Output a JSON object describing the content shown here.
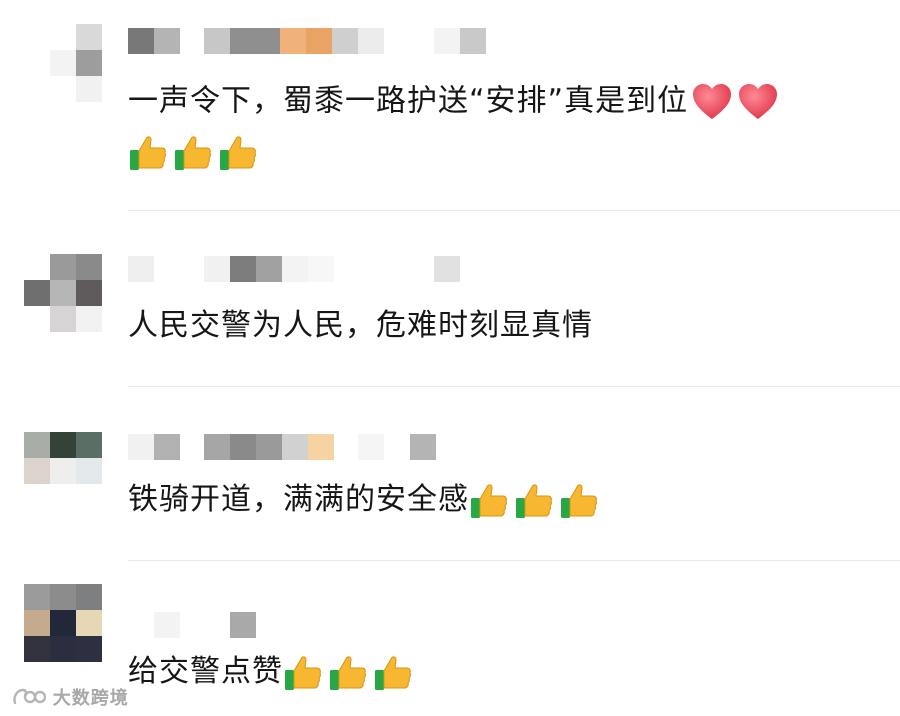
{
  "comments": [
    {
      "text": "一声令下，蜀黍一路护送“安排”真是到位",
      "emojis_inline": [
        "red-heart",
        "red-heart"
      ],
      "emojis_line2": [
        "thumbs-up",
        "thumbs-up",
        "thumbs-up"
      ]
    },
    {
      "text": "人民交警为人民，危难时刻显真情",
      "emojis_inline": [],
      "emojis_line2": []
    },
    {
      "text": "铁骑开道，满满的安全感",
      "emojis_inline": [
        "thumbs-up",
        "thumbs-up",
        "thumbs-up"
      ],
      "emojis_line2": []
    },
    {
      "text": "给交警点赞",
      "emojis_inline": [
        "thumbs-up",
        "thumbs-up",
        "thumbs-up"
      ],
      "emojis_line2": []
    }
  ],
  "watermark": {
    "text": "大数跨境",
    "icon": "brand-logo-icon"
  },
  "colors": {
    "text": "#161616",
    "divider": "#e9e9e9",
    "thumb": "#f7b731",
    "thumb_cuff": "#27a844",
    "heart": "#ef4f5f"
  }
}
